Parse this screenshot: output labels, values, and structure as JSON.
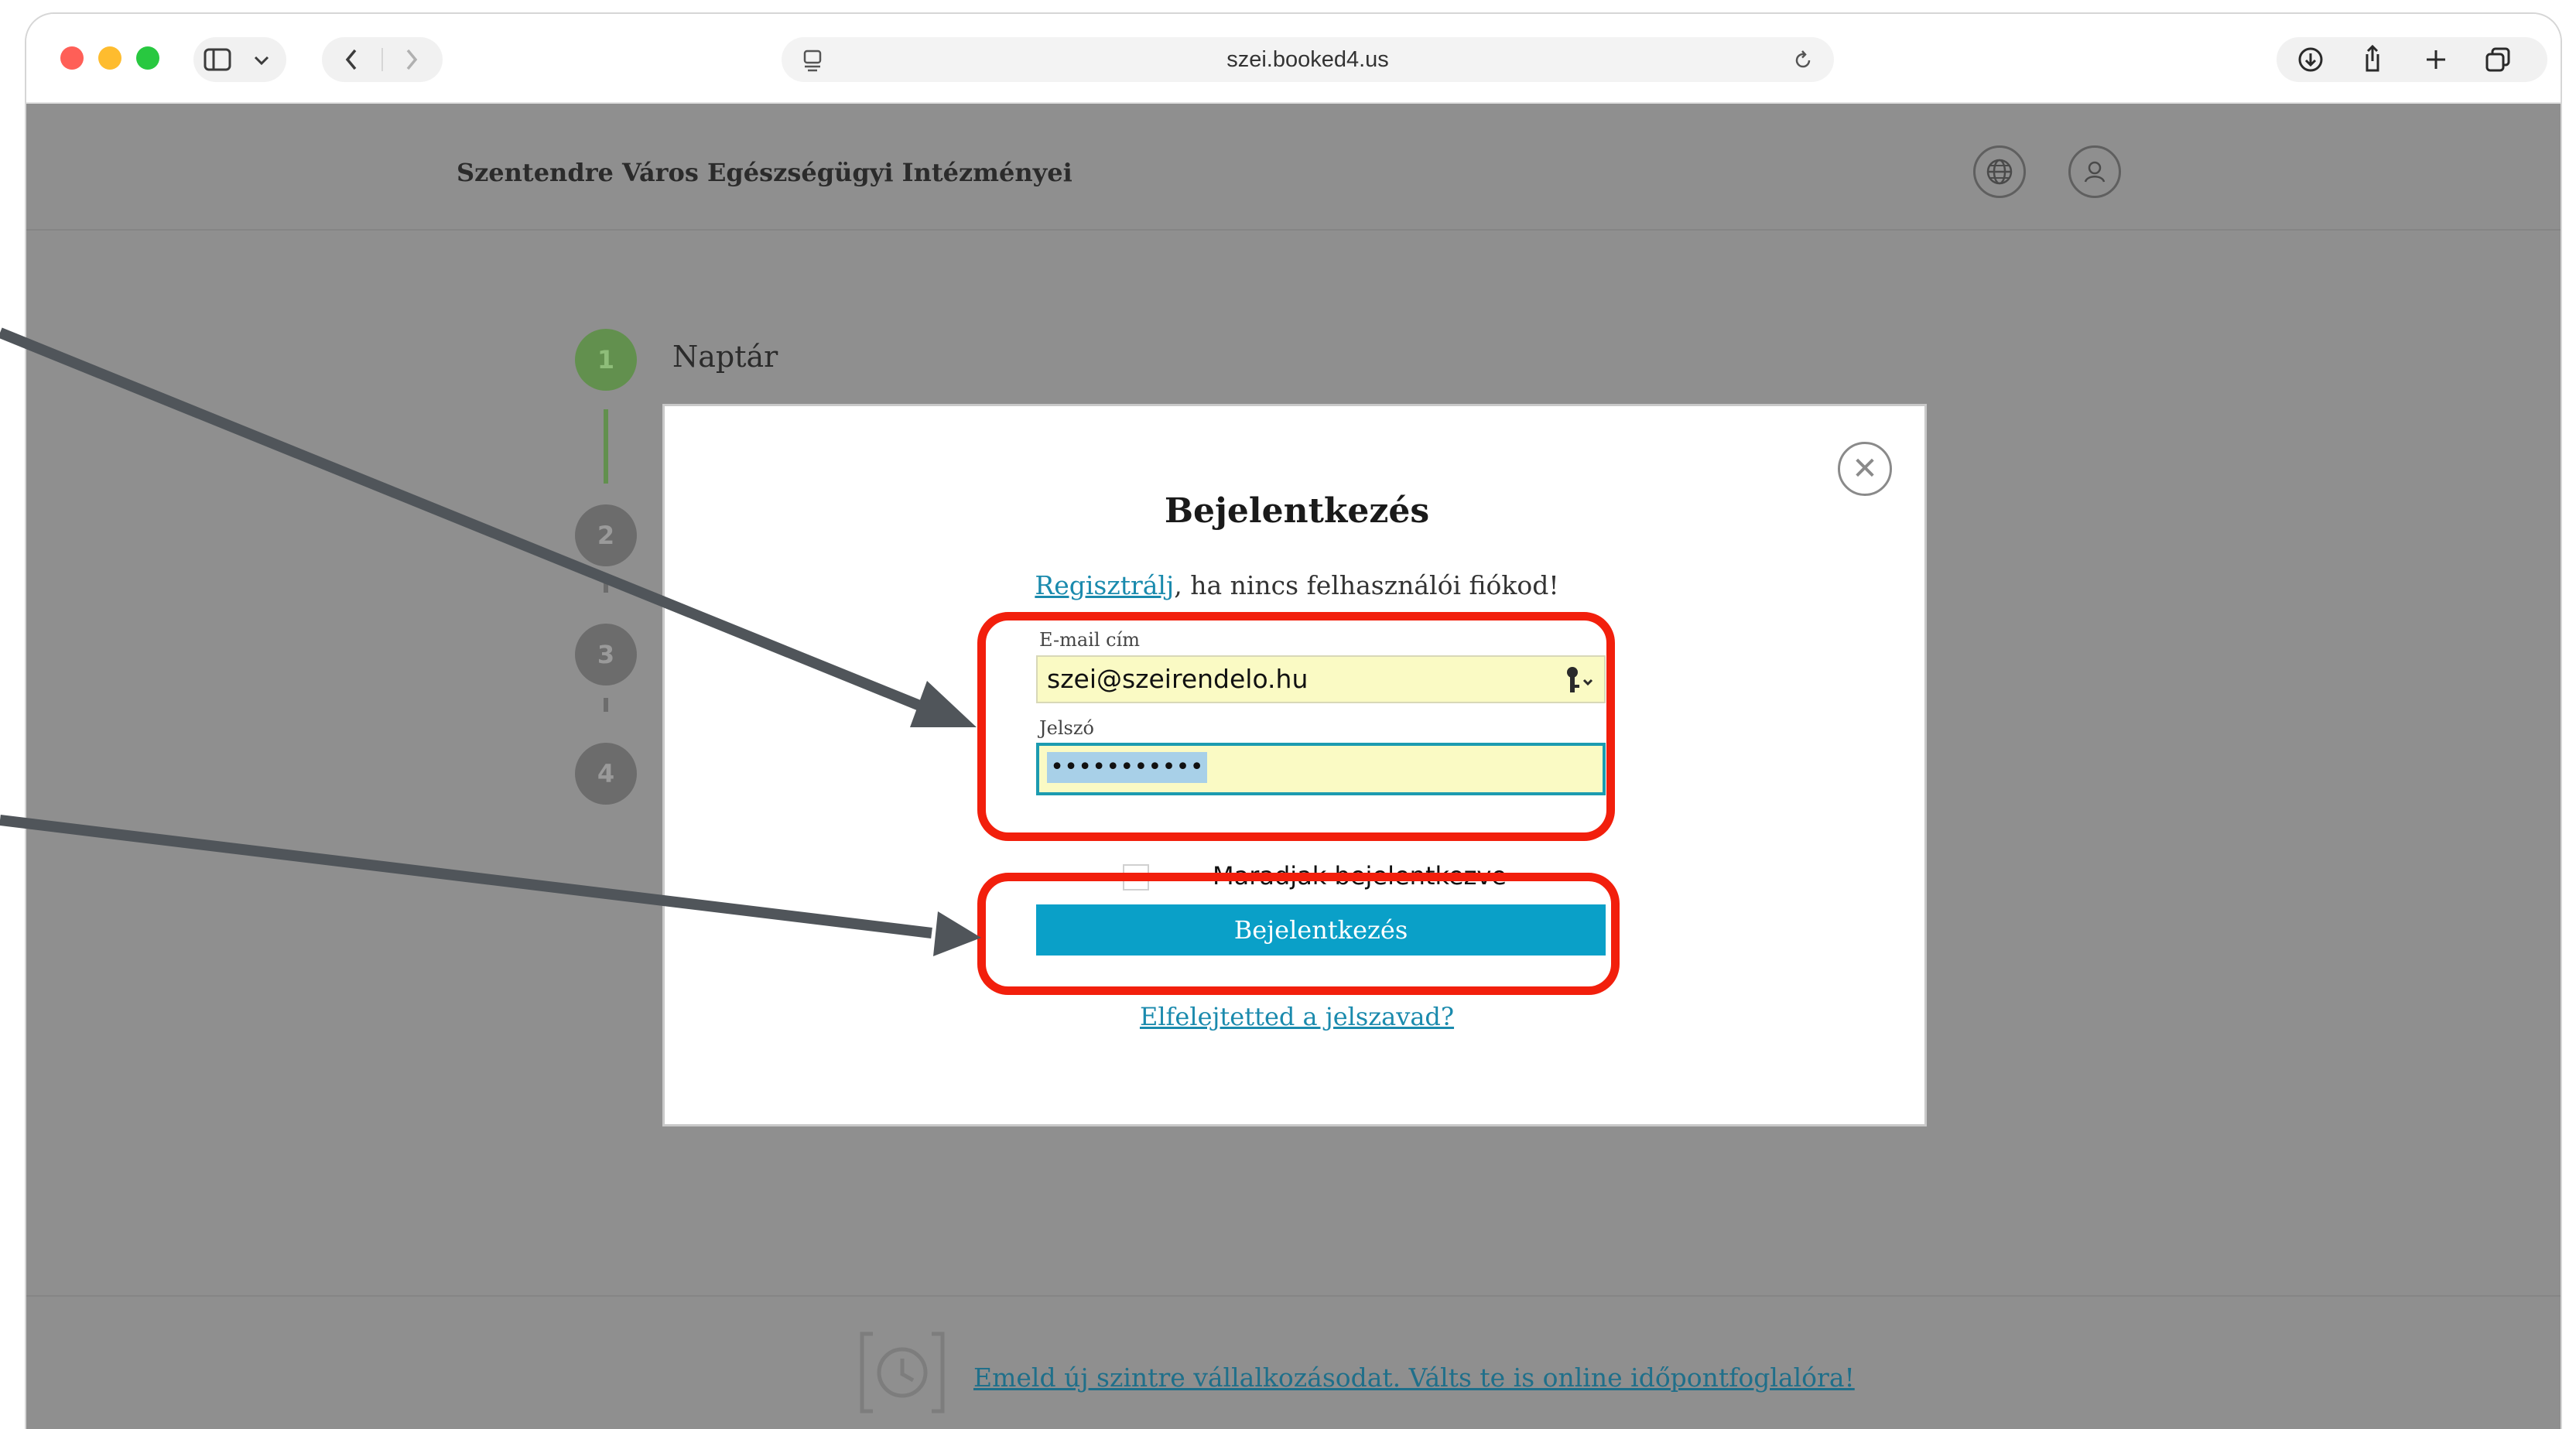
{
  "browser": {
    "url": "szei.booked4.us",
    "traffic_colors": {
      "close": "#ff5f57",
      "minimize": "#febc2e",
      "maximize": "#28c840"
    }
  },
  "site": {
    "title": "Szentendre Város Egészségügyi Intézményei"
  },
  "stepper": {
    "steps": [
      {
        "number": "1",
        "label": "Naptár",
        "active": true
      },
      {
        "number": "2"
      },
      {
        "number": "3"
      },
      {
        "number": "4"
      }
    ]
  },
  "modal": {
    "title": "Bejelentkezés",
    "register_link": "Regisztrálj",
    "register_text": ", ha nincs felhasználói fiókod!",
    "email_label": "E-mail cím",
    "email_value": "szei@szeirendelo.hu",
    "password_label": "Jelszó",
    "password_value": "•••••••••••",
    "remember_label": "Maradjak bejelentkezve",
    "login_button": "Bejelentkezés",
    "forgot_link": "Elfelejtetted a jelszavad?",
    "close_symbol": "✕"
  },
  "footer": {
    "link": "Emeld új szintre vállalkozásodat. Válts te is online időpontfoglalóra!"
  },
  "colors": {
    "accent": "#0aa0c8",
    "highlight": "#f21f0c",
    "arrow": "#50555a",
    "active_step": "#62904e"
  }
}
